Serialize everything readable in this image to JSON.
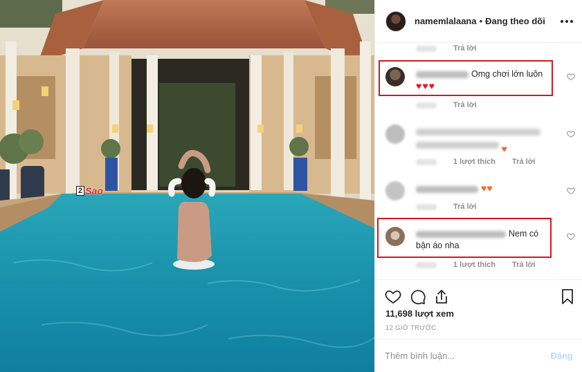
{
  "header": {
    "username": "namemlalaana",
    "separator": "•",
    "follow_status": "Đang theo dõi",
    "more_icon": "more-horizontal-icon"
  },
  "watermark": {
    "box": "2",
    "text": "Sao"
  },
  "labels": {
    "reply": "Trả lời",
    "likes_1": "1 lượt thích"
  },
  "comments": [
    {
      "text": "Omg chơi lớn luôn",
      "hearts": "♥♥♥",
      "highlighted": true
    },
    {
      "text": "",
      "emoji": "♥",
      "highlighted": false
    },
    {
      "text": "",
      "emoji": "♥♥",
      "highlighted": false
    },
    {
      "text": "Nem có bận áo nha",
      "highlighted": true
    }
  ],
  "actions": {
    "views": "11,698 lượt xem",
    "time": "12 GIỜ TRƯỚC"
  },
  "add_comment": {
    "placeholder": "Thêm bình luận...",
    "post_label": "Đăng"
  },
  "colors": {
    "highlight_box": "#d0181f",
    "pool_water": "#1d9fb4",
    "post_disabled": "#b3dbff"
  }
}
